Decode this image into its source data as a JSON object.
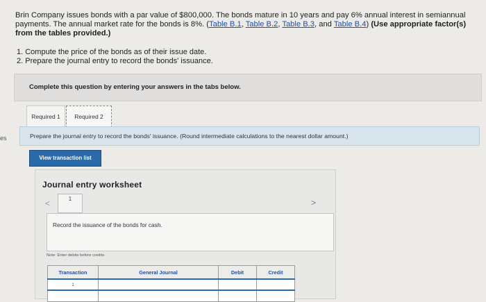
{
  "problem": {
    "text1": "Brin Company issues bonds with a par value of $800,000. The bonds mature in 10 years and pay 6% annual interest in semiannual payments. The annual market rate for the bonds is 8%. (",
    "link1": "Table B.1",
    "sep1": ", ",
    "link2": "Table B.2",
    "sep2": ", ",
    "link3": "Table B.3",
    "sep3": ", and ",
    "link4": "Table B.4",
    "text2": ") ",
    "bold": "(Use appropriate factor(s) from the tables provided.)"
  },
  "tasks": [
    "1. Compute the price of the bonds as of their issue date.",
    "2. Prepare the journal entry to record the bonds' issuance."
  ],
  "left_mark": "es",
  "banner": "Complete this question by entering your answers in the tabs below.",
  "tabs": [
    "Required 1",
    "Required 2"
  ],
  "instruction": "Prepare the journal entry to record the bonds' issuance. (Round intermediate calculations to the nearest dollar amount.)",
  "view_button": "View transaction list",
  "worksheet": {
    "title": "Journal entry worksheet",
    "page": "1",
    "record_text": "Record the issuance of the bonds for cash.",
    "note": "Note: Enter debits before credits."
  },
  "table": {
    "headers": [
      "Transaction",
      "General Journal",
      "Debit",
      "Credit"
    ],
    "row1_transaction": "1"
  },
  "nav": {
    "prev": "<",
    "next": ">"
  },
  "colors": {
    "link": "#1f4fa8",
    "button": "#2b6aa8",
    "instruction_bg": "#d7e4ec"
  }
}
